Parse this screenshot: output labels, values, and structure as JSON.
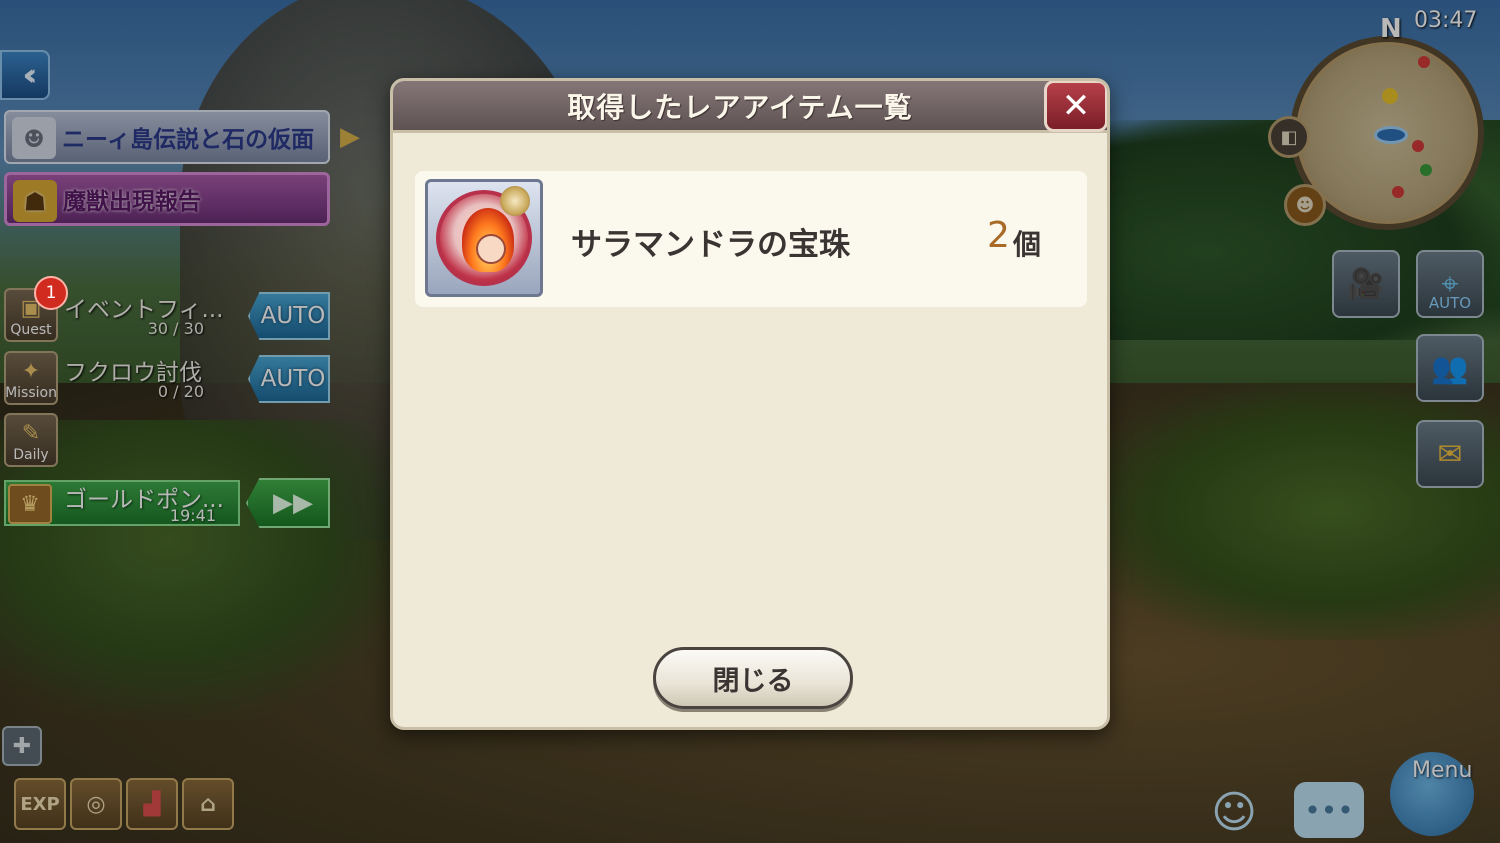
{
  "status": {
    "clock": "03:47",
    "compass_north": "N"
  },
  "left_hud": {
    "back_icon": "double-chevron-left-icon",
    "event_banner": {
      "text": "ニーィ島伝説と石の仮面"
    },
    "monster_banner": {
      "text": "魔獣出現報告"
    },
    "quests": [
      {
        "icon_label": "Quest",
        "badge": "1",
        "title": "イベントフィ...",
        "progress": "30 / 30",
        "auto": "AUTO"
      },
      {
        "icon_label": "Mission",
        "title": "フクロウ討伐",
        "progress": "0 / 20",
        "auto": "AUTO"
      },
      {
        "icon_label": "Daily"
      }
    ],
    "gold": {
      "title": "ゴールドポン...",
      "time": "19:41"
    },
    "bottom_icons": [
      "EXP",
      "skill-wheel-icon",
      "boot-icon",
      "cage-icon"
    ]
  },
  "right_hud": {
    "auto_tag": "AUTO",
    "menu_label": "Menu"
  },
  "modal": {
    "title": "取得したレアアイテム一覧",
    "items": [
      {
        "name": "サラマンドラの宝珠",
        "quantity": "2",
        "unit": "個"
      }
    ],
    "close_button": "閉じる"
  }
}
